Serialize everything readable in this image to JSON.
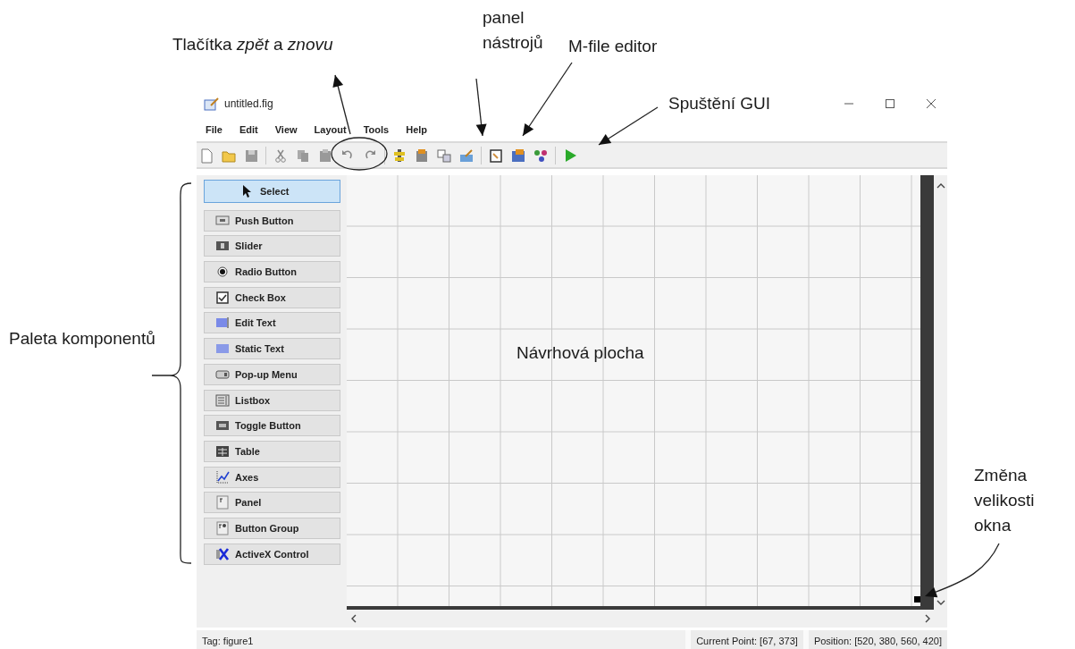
{
  "window": {
    "title": "untitled.fig"
  },
  "menu": [
    "File",
    "Edit",
    "View",
    "Layout",
    "Tools",
    "Help"
  ],
  "palette": [
    {
      "label": "Select",
      "selected": true
    },
    {
      "label": "Push Button",
      "selected": false
    },
    {
      "label": "Slider",
      "selected": false
    },
    {
      "label": "Radio Button",
      "selected": false
    },
    {
      "label": "Check Box",
      "selected": false
    },
    {
      "label": "Edit Text",
      "selected": false
    },
    {
      "label": "Static Text",
      "selected": false
    },
    {
      "label": "Pop-up Menu",
      "selected": false
    },
    {
      "label": "Listbox",
      "selected": false
    },
    {
      "label": "Toggle Button",
      "selected": false
    },
    {
      "label": "Table",
      "selected": false
    },
    {
      "label": "Axes",
      "selected": false
    },
    {
      "label": "Panel",
      "selected": false
    },
    {
      "label": "Button Group",
      "selected": false
    },
    {
      "label": "ActiveX Control",
      "selected": false
    }
  ],
  "status_bar": {
    "tag": "Tag: figure1",
    "current_point": "Current Point: [67, 373]",
    "position": "Position: [520, 380, 560, 420]"
  },
  "annotations": [
    {
      "text": "Tlačítka *zpět* a *znovu*"
    },
    {
      "text": "panel nástrojů"
    },
    {
      "text": "M-file editor"
    },
    {
      "text": "Spuštění GUI"
    },
    {
      "text": "Paleta komponentů"
    },
    {
      "text": "Návrhová plocha"
    },
    {
      "text": "Změna velikosti okna"
    }
  ]
}
